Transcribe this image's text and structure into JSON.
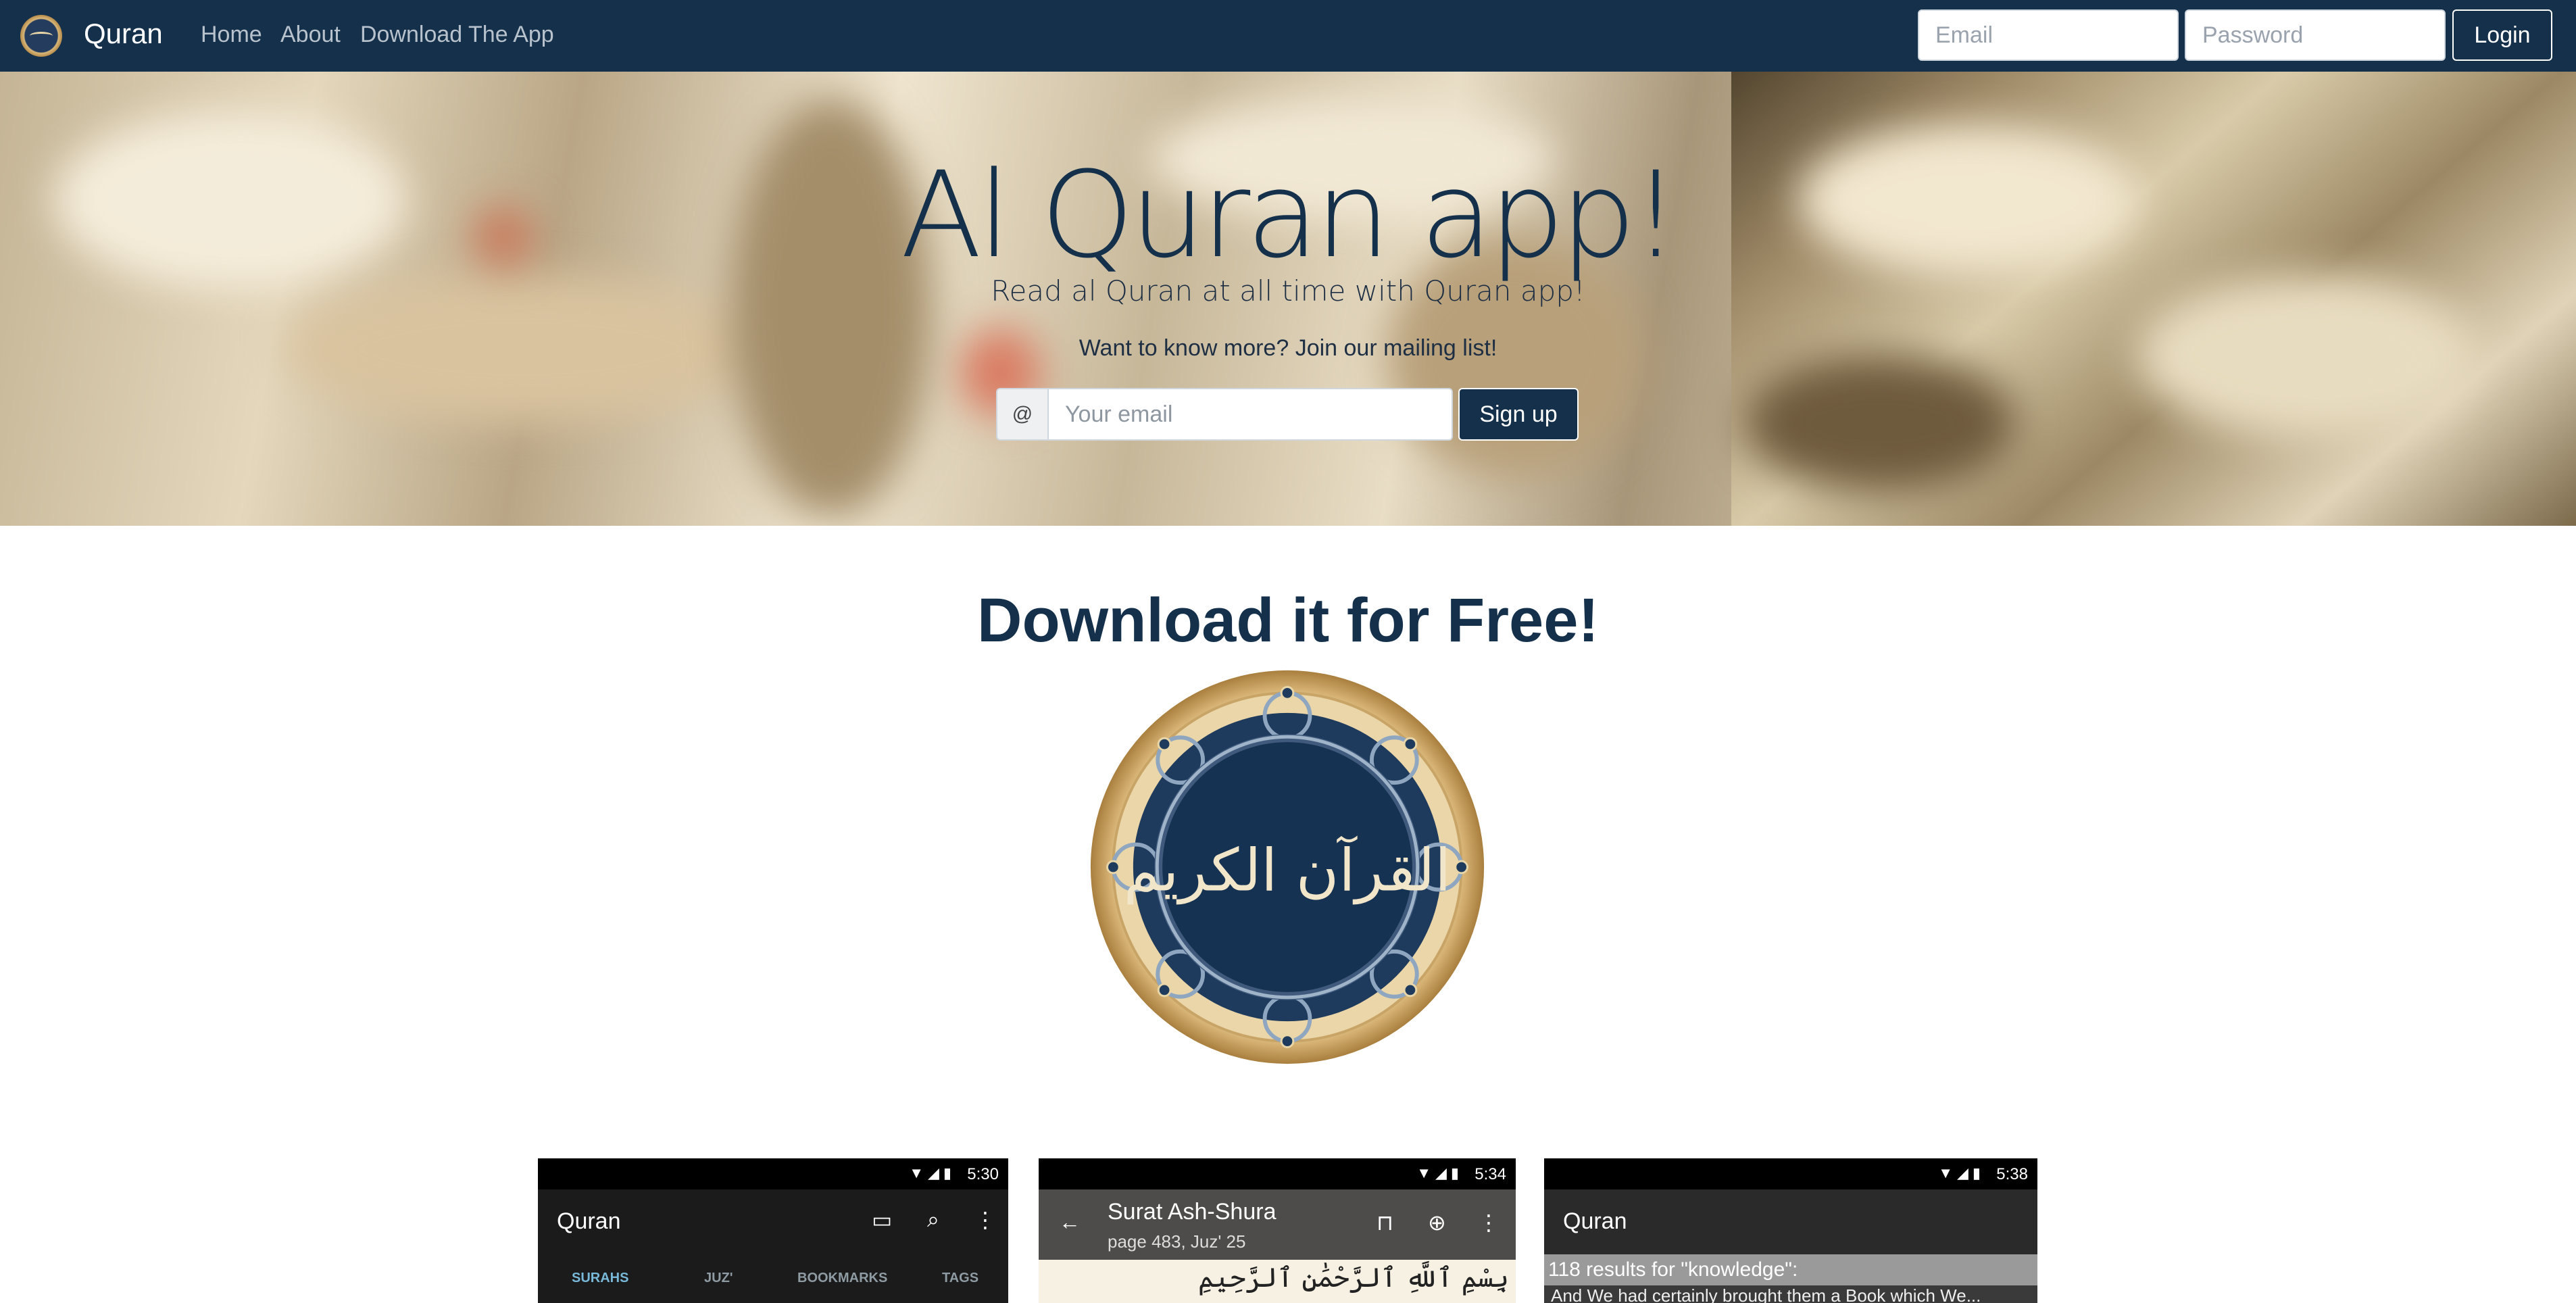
{
  "nav": {
    "brand": "Quran",
    "links": [
      "Home",
      "About",
      "Download The App"
    ],
    "email_placeholder": "Email",
    "password_placeholder": "Password",
    "login_label": "Login"
  },
  "hero": {
    "title": "Al Quran app!",
    "subtitle": "Read al Quran at all time with Quran app!",
    "cta": "Want to know more? Join our mailing list!",
    "at_symbol": "@",
    "email_placeholder": "Your email",
    "signup_label": "Sign up"
  },
  "download": {
    "title": "Download it for Free!",
    "logo_text": "القرآن الكريم"
  },
  "screenshots": [
    {
      "time": "5:30",
      "title": "Quran",
      "tabs": [
        "SURAHS",
        "JUZ'",
        "BOOKMARKS",
        "TAGS"
      ]
    },
    {
      "time": "5:34",
      "title": "Surat Ash-Shura",
      "subtitle": "page 483, Juz' 25",
      "bismillah": "بِسْمِ ٱللَّهِ ٱلرَّحْمَٰنِ ٱلرَّحِيمِ"
    },
    {
      "time": "5:38",
      "title": "Quran",
      "results": "118 results for \"knowledge\":",
      "result_line": "And We had certainly brought them a Book which We..."
    }
  ],
  "colors": {
    "navy": "#14304b",
    "gold": "#c9a467",
    "tab_active": "#78b8d8"
  },
  "icons": {
    "brand": "quran-logo-icon",
    "book": "book-icon",
    "search": "search-icon",
    "more": "more-vert-icon",
    "back": "arrow-back-icon",
    "bookmark": "bookmark-icon",
    "globe": "globe-icon"
  }
}
